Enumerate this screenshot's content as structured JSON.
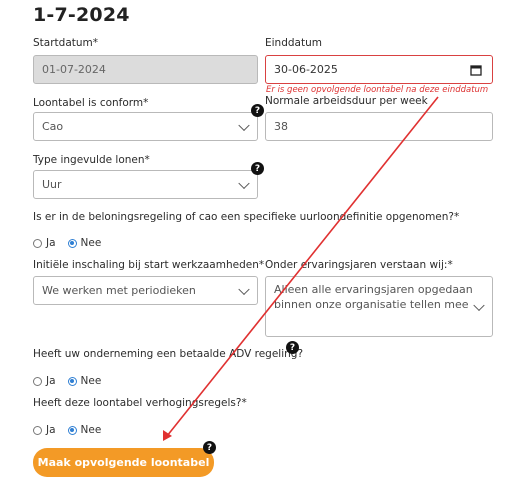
{
  "page": {
    "title": "1-7-2024"
  },
  "startdatum": {
    "label": "Startdatum*",
    "value": "01-07-2024"
  },
  "einddatum": {
    "label": "Einddatum",
    "value": "30-06-2025",
    "error": "Er is geen opvolgende loontabel na deze einddatum"
  },
  "loontabel_conform": {
    "label": "Loontabel is conform*",
    "value": "Cao"
  },
  "arbeidsduur": {
    "label": "Normale arbeidsduur per week",
    "value": "38"
  },
  "type_lonen": {
    "label": "Type ingevulde lonen*",
    "value": "Uur"
  },
  "uurloondefinitie": {
    "question": "Is er in de beloningsregeling of cao een specifieke uurloondefinitie opgenomen?*",
    "options": [
      "Ja",
      "Nee"
    ],
    "selected": "Nee"
  },
  "inschaling": {
    "label": "Initiële inschaling bij start werkzaamheden*",
    "value": "We werken met periodieken"
  },
  "ervaringsjaren": {
    "label": "Onder ervaringsjaren verstaan wij:*",
    "value_line1": "Alleen alle ervaringsjaren opgedaan",
    "value_line2": "binnen onze organisatie tellen mee"
  },
  "adv": {
    "question": "Heeft uw onderneming een betaalde ADV regeling?",
    "options": [
      "Ja",
      "Nee"
    ],
    "selected": "Nee"
  },
  "verhogingsregels": {
    "question": "Heeft deze loontabel verhogingsregels?*",
    "options": [
      "Ja",
      "Nee"
    ],
    "selected": "Nee"
  },
  "actions": {
    "make_next_label": "Maak opvolgende loontabel"
  },
  "help": {
    "glyph": "?"
  },
  "colors": {
    "accent": "#f39a26",
    "error": "#d33333",
    "annotation_arrow": "#e03131",
    "radio": "#2f7fd3"
  }
}
